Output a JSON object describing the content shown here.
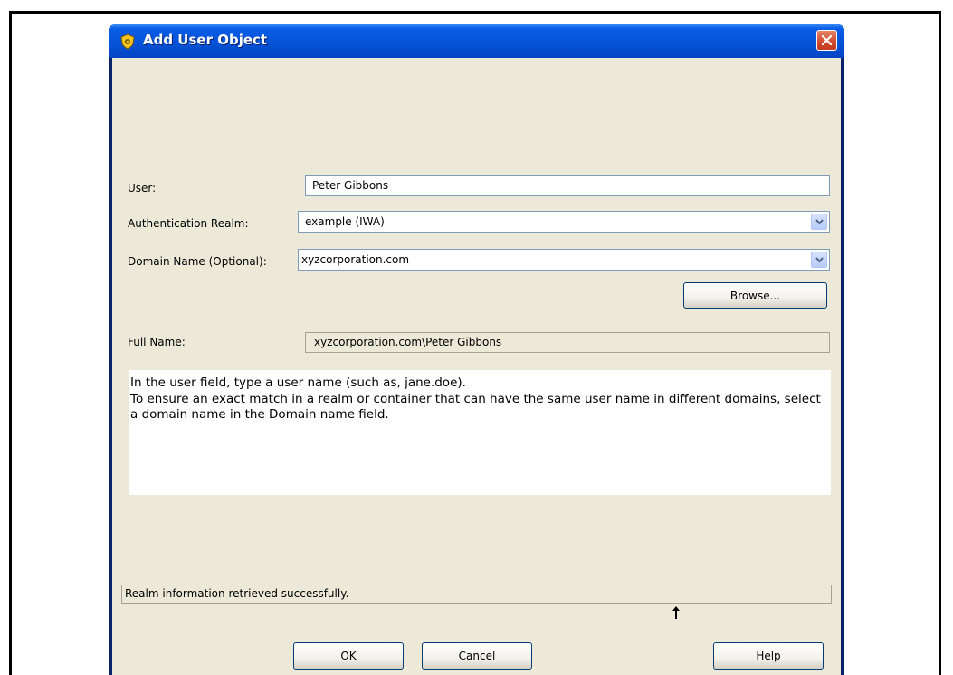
{
  "window": {
    "title": "Add User Object",
    "title_icon": "shield-gear-icon",
    "close_icon": "close-icon"
  },
  "form": {
    "user_label": "User:",
    "user_value": "Peter Gibbons",
    "realm_label": "Authentication Realm:",
    "realm_value": "example (IWA)",
    "domain_label": "Domain Name (Optional):",
    "domain_value": "xyzcorporation.com",
    "browse_label": "Browse...",
    "fullname_label": "Full Name:",
    "fullname_value": "xyzcorporation.com\\Peter Gibbons"
  },
  "help_text": "In the user field, type a user name (such as, jane.doe).\nTo ensure an exact match in a realm or container that can have the same user name in different domains, select a domain name in the Domain name field.",
  "status_text": "Realm information retrieved successfully.",
  "buttons": {
    "ok": "OK",
    "cancel": "Cancel",
    "help": "Help"
  },
  "colors": {
    "titlebar": "#0552d6",
    "client_bg": "#ece9d8",
    "close_button": "#d24a2c"
  }
}
